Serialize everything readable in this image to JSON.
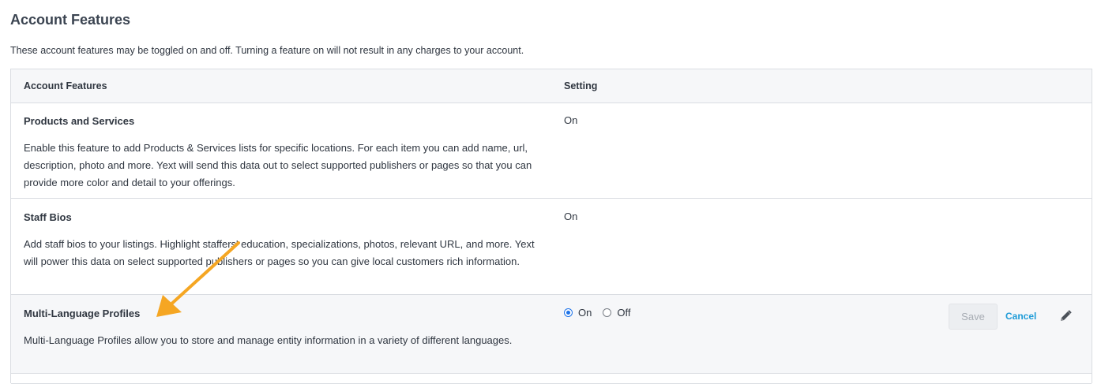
{
  "page_title": "Account Features",
  "intro_text": "These account features may be toggled on and off. Turning a feature on will not result in any charges to your account.",
  "table": {
    "headers": {
      "feature": "Account Features",
      "setting": "Setting"
    },
    "rows": [
      {
        "title": "Products and Services",
        "description": "Enable this feature to add Products & Services lists for specific locations. For each item you can add name, url, description, photo and more. Yext will send this data out to select supported publishers or pages so that you can provide more color and detail to your offerings.",
        "setting": "On"
      },
      {
        "title": "Staff Bios",
        "description": "Add staff bios to your listings. Highlight staffers' education, specializations, photos, relevant URL, and more. Yext will power this data on select supported publishers or pages so you can give local customers rich information.",
        "setting": "On"
      },
      {
        "title": "Multi-Language Profiles",
        "description": "Multi-Language Profiles allow you to store and manage entity information in a variety of different languages.",
        "options": [
          "On",
          "Off"
        ],
        "selected": "On",
        "save_label": "Save",
        "cancel_label": "Cancel"
      }
    ]
  },
  "colors": {
    "accent": "#1e73e8",
    "link": "#1e9bd7",
    "annotation_arrow": "#f5a623"
  },
  "icons": {
    "edit": "pencil-icon",
    "annotation": "arrow-annotation"
  }
}
